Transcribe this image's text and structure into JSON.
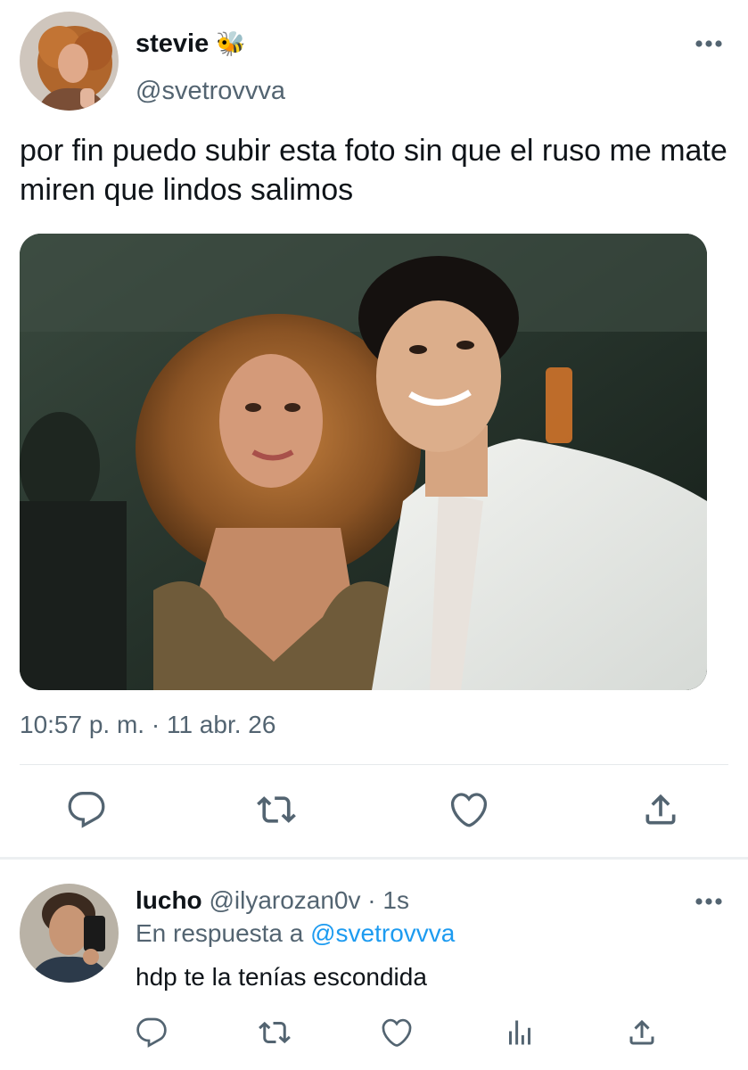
{
  "tweet": {
    "author": {
      "display_name": "stevie",
      "emoji": "🐝",
      "handle": "@svetrovvva"
    },
    "text": "por fin puedo subir esta foto sin que el ruso me mate miren que lindos salimos",
    "timestamp": "10:57 p. m. · 11 abr. 26",
    "more_icon": "more-horizontal-icon",
    "actions": [
      "reply-icon",
      "retweet-icon",
      "like-icon",
      "share-icon"
    ]
  },
  "reply": {
    "author": {
      "display_name": "lucho",
      "handle": "@ilyarozan0v",
      "time": "· 1s"
    },
    "replying_to_prefix": "En respuesta a",
    "replying_to_handle": "@svetrovvva",
    "text": "hdp te la tenías escondida",
    "actions": [
      "reply-icon",
      "retweet-icon",
      "like-icon",
      "analytics-icon",
      "share-icon"
    ]
  },
  "colors": {
    "text_primary": "#0f1419",
    "text_secondary": "#536471",
    "accent": "#1d9bf0",
    "divider": "#e6e9eb"
  }
}
